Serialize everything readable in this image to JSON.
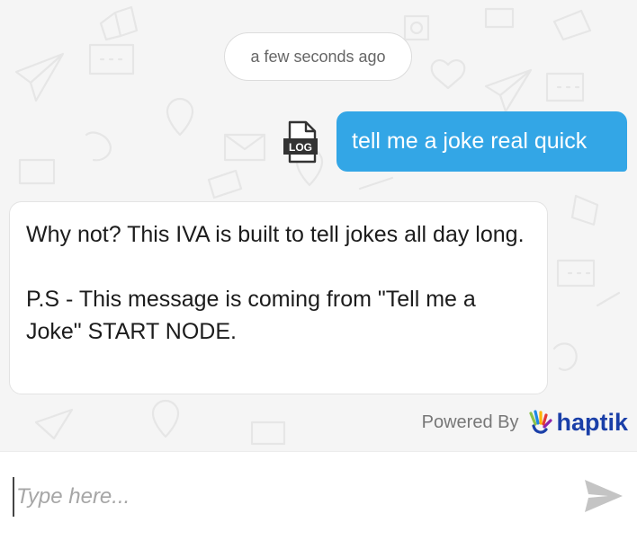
{
  "chat": {
    "timestamp": "a few seconds ago",
    "log_icon": "log-file-icon",
    "log_label": "LOG",
    "user_message": "tell me a joke real quick",
    "bot_message_line1": "Why not? This IVA is built to tell jokes all day long.",
    "bot_message_line2": "P.S - This message is coming from \"Tell me a Joke\" START NODE."
  },
  "branding": {
    "powered_by": "Powered By",
    "brand": "haptik",
    "logo_icon": "haptik-hand-icon"
  },
  "composer": {
    "placeholder": "Type here...",
    "value": "",
    "send_icon": "send-icon"
  },
  "colors": {
    "user_bubble": "#33a6e6",
    "brand": "#1a3fa8",
    "background": "#f5f5f5"
  }
}
